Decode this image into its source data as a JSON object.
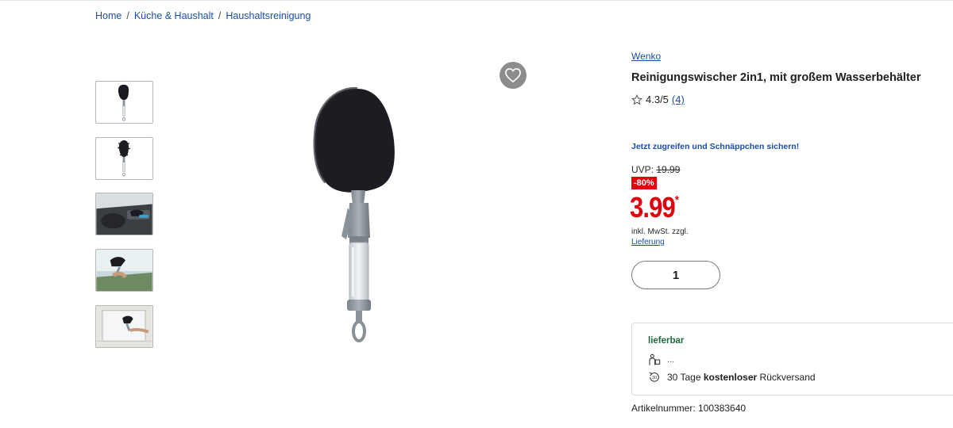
{
  "breadcrumb": {
    "items": [
      "Home",
      "Küche & Haushalt",
      "Haushaltsreinigung"
    ],
    "separator": "/"
  },
  "gallery": {
    "thumbnails": [
      "product-front",
      "product-brush",
      "car-interior-cleaning",
      "windshield-cleaning",
      "mirror-cleaning"
    ],
    "main_image": "product-front"
  },
  "favorite": {
    "icon": "heart-icon"
  },
  "product": {
    "brand": "Wenko",
    "title": "Reinigungswischer 2in1, mit großem Wasserbehälter",
    "rating": {
      "value": "4.3/5",
      "count": "(4)",
      "icon": "star-icon"
    },
    "promo": "Jetzt zugreifen und Schnäppchen sichern!",
    "uvp_label": "UVP:",
    "uvp_price": "19.99",
    "discount": "-80%",
    "price": "3.99",
    "price_mark": "*",
    "tax_note": "inkl. MwSt. zzgl.",
    "shipping_link": "Lieferung",
    "quantity": "1",
    "article_number": "Artikelnummer: 100383640"
  },
  "availability": {
    "status": "lieferbar",
    "delivery_info": "...",
    "return_prefix": "30 Tage ",
    "return_bold": "kostenloser",
    "return_suffix": " Rückversand"
  },
  "colors": {
    "link": "#1a4fa5",
    "price": "#e3000b",
    "available": "#1c6b3a",
    "favorite_bg": "#8d8d8d"
  }
}
